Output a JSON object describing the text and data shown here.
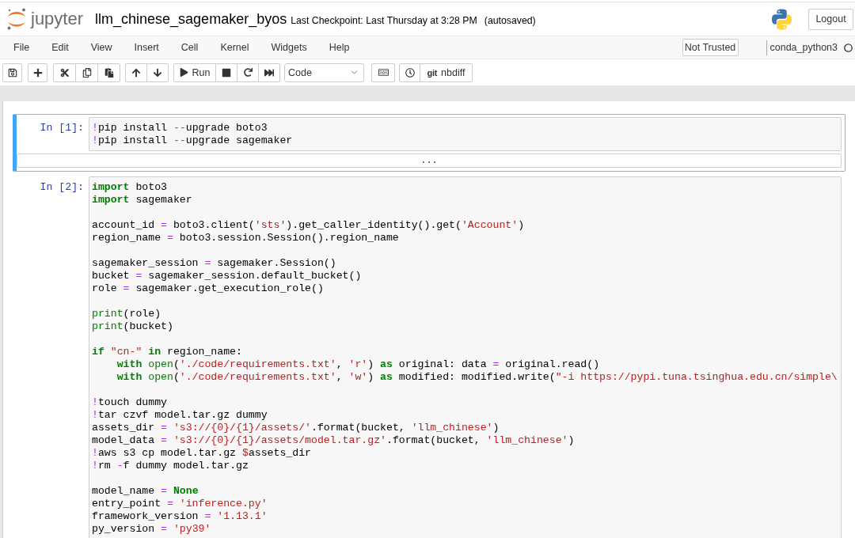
{
  "header": {
    "logo_text": "jupyter",
    "notebook_title": "llm_chinese_sagemaker_byos",
    "checkpoint": "Last Checkpoint: Last Thursday at 3:28 PM",
    "autosave_status": "(autosaved)",
    "logout_button": "Logout"
  },
  "menu_bar": {
    "items": [
      {
        "label": "File"
      },
      {
        "label": "Edit"
      },
      {
        "label": "View"
      },
      {
        "label": "Insert"
      },
      {
        "label": "Cell"
      },
      {
        "label": "Kernel"
      },
      {
        "label": "Widgets"
      },
      {
        "label": "Help"
      }
    ],
    "trust_button": "Not Trusted",
    "kernel": {
      "name": "conda_python3",
      "busy": false
    }
  },
  "toolbar": {
    "run_button": "Run",
    "cell_type_select": {
      "value": "Code"
    },
    "nbdiff_button": {
      "logo": "git",
      "label": "nbdiff"
    }
  },
  "cells": [
    {
      "prompt": "In [1]:",
      "selected": true,
      "collapsed_output": "...",
      "blocks": [
        [
          {
            "tokens": [
              {
                "kind": "operator",
                "text": "!"
              },
              {
                "kind": "plain",
                "text": "pip install "
              },
              {
                "kind": "operator",
                "text": "--"
              },
              {
                "kind": "plain",
                "text": "upgrade boto3"
              }
            ]
          },
          {
            "tokens": [
              {
                "kind": "operator",
                "text": "!"
              },
              {
                "kind": "plain",
                "text": "pip install "
              },
              {
                "kind": "operator",
                "text": "--"
              },
              {
                "kind": "plain",
                "text": "upgrade sagemaker"
              }
            ]
          }
        ]
      ]
    },
    {
      "prompt": "In [2]:",
      "selected": false,
      "blocks": [
        [
          {
            "tokens": [
              {
                "kind": "keyword",
                "text": "import"
              },
              {
                "kind": "plain",
                "text": " boto3"
              }
            ]
          },
          {
            "tokens": [
              {
                "kind": "keyword",
                "text": "import"
              },
              {
                "kind": "plain",
                "text": " sagemaker"
              }
            ]
          }
        ],
        [
          {
            "tokens": [
              {
                "kind": "plain",
                "text": "account_id "
              },
              {
                "kind": "operator",
                "text": "="
              },
              {
                "kind": "plain",
                "text": " boto3.client("
              },
              {
                "kind": "string",
                "text": "'sts'"
              },
              {
                "kind": "plain",
                "text": ").get_caller_identity().get("
              },
              {
                "kind": "string",
                "text": "'Account'"
              },
              {
                "kind": "plain",
                "text": ")"
              }
            ]
          },
          {
            "tokens": [
              {
                "kind": "plain",
                "text": "region_name "
              },
              {
                "kind": "operator",
                "text": "="
              },
              {
                "kind": "plain",
                "text": " boto3.session.Session().region_name"
              }
            ]
          }
        ],
        [
          {
            "tokens": [
              {
                "kind": "plain",
                "text": "sagemaker_session "
              },
              {
                "kind": "operator",
                "text": "="
              },
              {
                "kind": "plain",
                "text": " sagemaker.Session()"
              }
            ]
          },
          {
            "tokens": [
              {
                "kind": "plain",
                "text": "bucket "
              },
              {
                "kind": "operator",
                "text": "="
              },
              {
                "kind": "plain",
                "text": " sagemaker_session.default_bucket()"
              }
            ]
          },
          {
            "tokens": [
              {
                "kind": "plain",
                "text": "role "
              },
              {
                "kind": "operator",
                "text": "="
              },
              {
                "kind": "plain",
                "text": " sagemaker.get_execution_role()"
              }
            ]
          }
        ],
        [
          {
            "tokens": [
              {
                "kind": "builtin",
                "text": "print"
              },
              {
                "kind": "plain",
                "text": "(role)"
              }
            ]
          },
          {
            "tokens": [
              {
                "kind": "builtin",
                "text": "print"
              },
              {
                "kind": "plain",
                "text": "(bucket)"
              }
            ]
          }
        ],
        [
          {
            "tokens": [
              {
                "kind": "keyword",
                "text": "if "
              },
              {
                "kind": "string",
                "text": "\"cn-\" "
              },
              {
                "kind": "keyword",
                "text": "in"
              },
              {
                "kind": "plain",
                "text": " region_name:"
              }
            ],
            "children": [
              {
                "tokens": [
                  {
                    "kind": "keyword",
                    "text": "with "
                  },
                  {
                    "kind": "builtin",
                    "text": "open"
                  },
                  {
                    "kind": "plain",
                    "text": "("
                  },
                  {
                    "kind": "string",
                    "text": "'./code/requirements.txt'"
                  },
                  {
                    "kind": "plain",
                    "text": ", "
                  },
                  {
                    "kind": "string",
                    "text": "'r'"
                  },
                  {
                    "kind": "plain",
                    "text": ") "
                  },
                  {
                    "kind": "keyword",
                    "text": "as"
                  },
                  {
                    "kind": "plain",
                    "text": " original: data "
                  },
                  {
                    "kind": "operator",
                    "text": "="
                  },
                  {
                    "kind": "plain",
                    "text": " original.read()"
                  }
                ]
              },
              {
                "tokens": [
                  {
                    "kind": "keyword",
                    "text": "with "
                  },
                  {
                    "kind": "builtin",
                    "text": "open"
                  },
                  {
                    "kind": "plain",
                    "text": "("
                  },
                  {
                    "kind": "string",
                    "text": "'./code/requirements.txt'"
                  },
                  {
                    "kind": "plain",
                    "text": ", "
                  },
                  {
                    "kind": "string",
                    "text": "'w'"
                  },
                  {
                    "kind": "plain",
                    "text": ") "
                  },
                  {
                    "kind": "keyword",
                    "text": "as"
                  },
                  {
                    "kind": "plain",
                    "text": " modified: modified.write("
                  },
                  {
                    "kind": "string",
                    "text": "\"-i https://pypi.tuna.tsinghua.edu.cn/simple\\"
                  }
                ]
              }
            ]
          }
        ],
        [
          {
            "tokens": [
              {
                "kind": "operator",
                "text": "!"
              },
              {
                "kind": "plain",
                "text": "touch dummy"
              }
            ]
          },
          {
            "tokens": [
              {
                "kind": "operator",
                "text": "!"
              },
              {
                "kind": "plain",
                "text": "tar czvf model.tar.gz dummy"
              }
            ]
          },
          {
            "tokens": [
              {
                "kind": "plain",
                "text": "assets_dir "
              },
              {
                "kind": "operator",
                "text": "= "
              },
              {
                "kind": "string",
                "text": "'s3://{0}/{1}/assets/'"
              },
              {
                "kind": "plain",
                "text": ".format(bucket, "
              },
              {
                "kind": "string",
                "text": "'llm_chinese'"
              },
              {
                "kind": "plain",
                "text": ")"
              }
            ]
          },
          {
            "tokens": [
              {
                "kind": "plain",
                "text": "model_data "
              },
              {
                "kind": "operator",
                "text": "= "
              },
              {
                "kind": "string",
                "text": "'s3://{0}/{1}/assets/model.tar.gz'"
              },
              {
                "kind": "plain",
                "text": ".format(bucket, "
              },
              {
                "kind": "string",
                "text": "'llm_chinese'"
              },
              {
                "kind": "plain",
                "text": ")"
              }
            ]
          },
          {
            "tokens": [
              {
                "kind": "operator",
                "text": "!"
              },
              {
                "kind": "plain",
                "text": "aws s3 cp model.tar.gz "
              },
              {
                "kind": "variable",
                "text": "$"
              },
              {
                "kind": "plain",
                "text": "assets_dir"
              }
            ]
          },
          {
            "tokens": [
              {
                "kind": "operator",
                "text": "!"
              },
              {
                "kind": "plain",
                "text": "rm "
              },
              {
                "kind": "operator",
                "text": "-"
              },
              {
                "kind": "plain",
                "text": "f dummy model.tar.gz"
              }
            ]
          }
        ],
        [
          {
            "tokens": [
              {
                "kind": "plain",
                "text": "model_name "
              },
              {
                "kind": "operator",
                "text": "= "
              },
              {
                "kind": "keyword",
                "text": "None"
              }
            ]
          },
          {
            "tokens": [
              {
                "kind": "plain",
                "text": "entry_point "
              },
              {
                "kind": "operator",
                "text": "= "
              },
              {
                "kind": "string",
                "text": "'inference.py'"
              }
            ]
          },
          {
            "tokens": [
              {
                "kind": "plain",
                "text": "framework_version "
              },
              {
                "kind": "operator",
                "text": "= "
              },
              {
                "kind": "string",
                "text": "'1.13.1'"
              }
            ]
          },
          {
            "tokens": [
              {
                "kind": "plain",
                "text": "py_version "
              },
              {
                "kind": "operator",
                "text": "= "
              },
              {
                "kind": "string",
                "text": "'py39'"
              }
            ]
          }
        ]
      ]
    }
  ]
}
